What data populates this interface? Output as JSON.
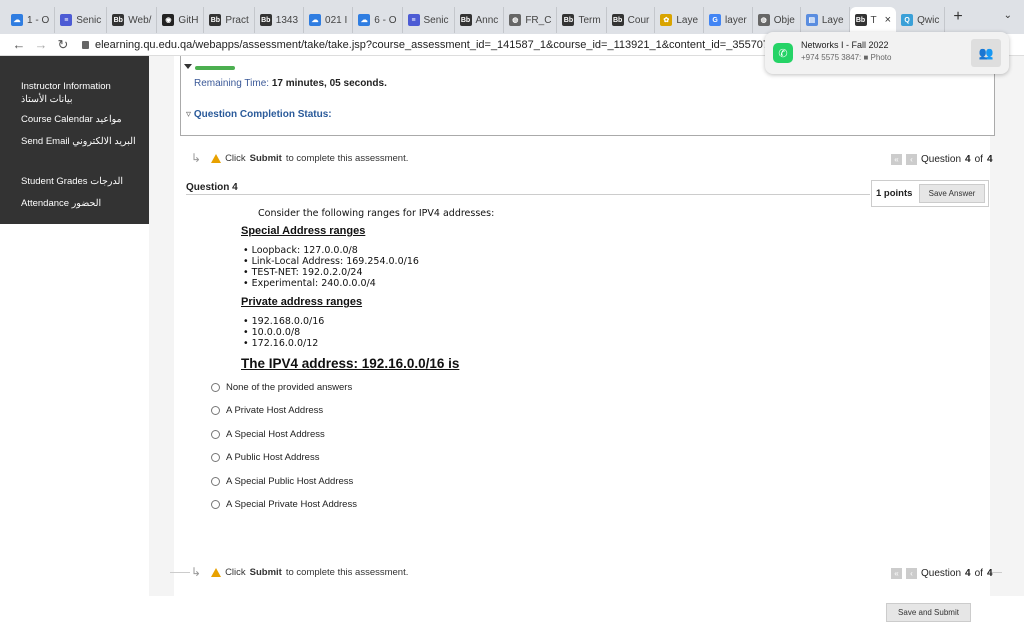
{
  "browser": {
    "tabs": [
      {
        "label": "1 - O",
        "icon": "cloud-icon",
        "color": "#2f7de1"
      },
      {
        "label": "Senic",
        "icon": "list-icon",
        "color": "#4c5bd4"
      },
      {
        "label": "Web/",
        "icon": "bb-icon",
        "color": "#333333"
      },
      {
        "label": "GitH",
        "icon": "github-icon",
        "color": "#222222"
      },
      {
        "label": "Pract",
        "icon": "bb-icon",
        "color": "#333333"
      },
      {
        "label": "1343",
        "icon": "bb-icon",
        "color": "#333333"
      },
      {
        "label": "021 I",
        "icon": "cloud-icon",
        "color": "#2f7de1"
      },
      {
        "label": "6 - O",
        "icon": "cloud-icon",
        "color": "#2f7de1"
      },
      {
        "label": "Senic",
        "icon": "list-icon",
        "color": "#4c5bd4"
      },
      {
        "label": "Annc",
        "icon": "bb-icon",
        "color": "#333333"
      },
      {
        "label": "FR_C",
        "icon": "globe-icon",
        "color": "#666666"
      },
      {
        "label": "Term",
        "icon": "bb-icon",
        "color": "#333333"
      },
      {
        "label": "Cour",
        "icon": "bb-icon",
        "color": "#333333"
      },
      {
        "label": "Laye",
        "icon": "leaf-icon",
        "color": "#d9a400"
      },
      {
        "label": "layer",
        "icon": "google-icon",
        "color": "#4285f4"
      },
      {
        "label": "Obje",
        "icon": "globe-icon",
        "color": "#666666"
      },
      {
        "label": "Laye",
        "icon": "doc-icon",
        "color": "#5a8de0"
      },
      {
        "label": "T",
        "icon": "bb-icon",
        "color": "#333333",
        "active": true
      },
      {
        "label": "Qwic",
        "icon": "ql-icon",
        "color": "#3aa0d8"
      }
    ],
    "new_tab": "+",
    "tab_menu": "⌄",
    "url": "elearning.qu.edu.qa/webapps/assessment/take/take.jsp?course_assessment_id=_141587_1&course_id=_113921_1&content_id=_3557077_1&ques"
  },
  "notification": {
    "title": "Networks I - Fall 2022",
    "subtitle": "+974 5575 3847: ■ Photo"
  },
  "sidebar": {
    "items": [
      {
        "label": "Instructor Information",
        "label_ar": "بيانات الأستاذ"
      },
      {
        "label": "Course Calendar مواعيد"
      },
      {
        "label": "Send Email البريد الالكتروني"
      },
      {
        "label": "Student Grades الدرجات"
      },
      {
        "label": "Attendance الحضور"
      }
    ]
  },
  "status": {
    "progress": 0.05,
    "remaining_label": "Remaining Time:",
    "remaining_value": "17 minutes, 05 seconds.",
    "completion_label": "Question Completion Status:"
  },
  "instruction": {
    "prefix": "Click",
    "bold": "Submit",
    "suffix": "to complete this assessment."
  },
  "qnav": {
    "text_prefix": "Question",
    "current": "4",
    "of": "of",
    "total": "4"
  },
  "question": {
    "title": "Question 4",
    "points": "1 points",
    "save_label": "Save Answer",
    "intro": "Consider the following ranges for IPV4 addresses:",
    "special_header": "Special Address ranges",
    "special_items": [
      "• Loopback: 127.0.0.0/8",
      "• Link-Local Address: 169.254.0.0/16",
      "• TEST-NET: 192.0.2.0/24",
      "• Experimental: 240.0.0.0/4"
    ],
    "private_header": "Private address ranges",
    "private_items": [
      "• 192.168.0.0/16",
      "• 10.0.0.0/8",
      "• 172.16.0.0/12"
    ],
    "prompt": "The IPV4 address:  192.16.0.0/16 is",
    "options": [
      "None of the provided answers",
      "A Private Host Address",
      "A Special Host Address",
      "A Public Host Address",
      "A Special Public Host Address",
      "A Special Private Host Address"
    ]
  },
  "footer": {
    "save_submit": "Save and Submit"
  }
}
